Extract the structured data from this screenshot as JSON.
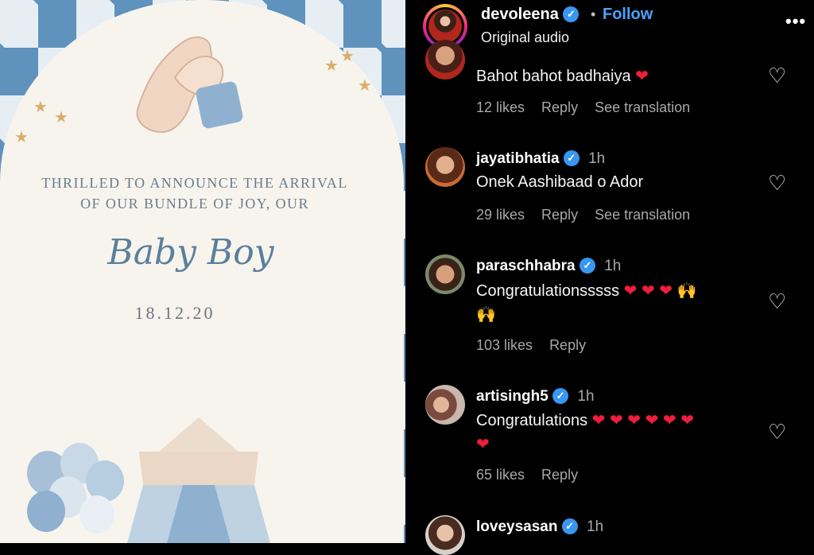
{
  "post": {
    "announce_line1": "THRILLED TO ANNOUNCE THE ARRIVAL",
    "announce_line2": "OF OUR BUNDLE OF JOY, OUR",
    "baby_text": "Baby Boy",
    "date": "18.12.20"
  },
  "header": {
    "username": "devoleena",
    "follow_label": "Follow",
    "subtitle": "Original audio",
    "more_label": "•••"
  },
  "comments": [
    {
      "username": "",
      "time": "",
      "text": "Bahot bahot badhaiya",
      "emoji": "❤",
      "likes": "12 likes",
      "reply": "Reply",
      "translate": "See translation"
    },
    {
      "username": "jayatibhatia",
      "time": "1h",
      "text": "Onek Aashibaad o Ador",
      "likes": "29 likes",
      "reply": "Reply",
      "translate": "See translation"
    },
    {
      "username": "paraschhabra",
      "time": "1h",
      "text": "Congratulationsssss",
      "emoji_line1": "❤ ❤ ❤",
      "hands": "🙌",
      "likes": "103 likes",
      "reply": "Reply"
    },
    {
      "username": "artisingh5",
      "time": "1h",
      "text": "Congratulations",
      "emoji_line1": "❤ ❤ ❤ ❤ ❤ ❤",
      "emoji_line2": "❤",
      "likes": "65 likes",
      "reply": "Reply"
    },
    {
      "username": "loveysasan",
      "time": "1h"
    }
  ],
  "colors": {
    "accent_follow": "#4aa3ff",
    "verified": "#3897f0",
    "heart": "#ef1e3c",
    "panel_bg": "#000000",
    "card_bg": "#f7f4ee",
    "card_pattern": "#5f92bd"
  },
  "icons": [
    "verified-badge-icon",
    "heart-outline-icon",
    "more-icon"
  ]
}
